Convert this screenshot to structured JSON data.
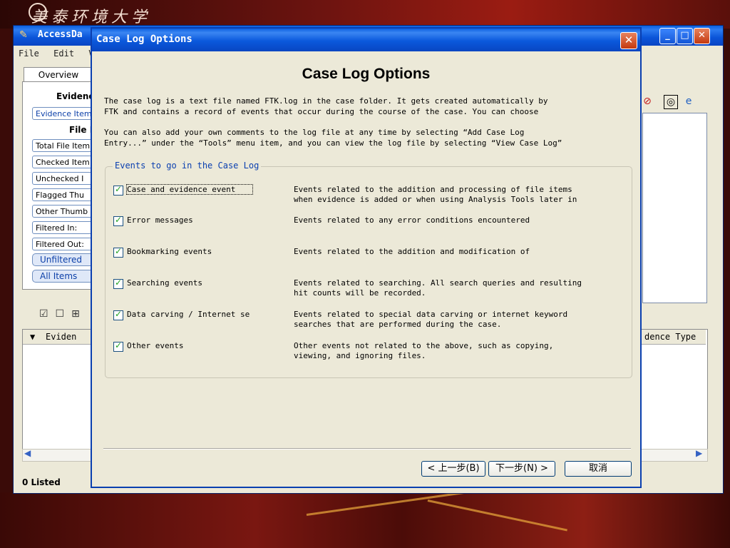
{
  "background": {
    "logo_text": "美泰环境大学",
    "colors": {
      "dark_red": "#3a0b08",
      "accent_gold": "#e3a23a"
    }
  },
  "main_window": {
    "title": "AccessDa",
    "menu": [
      "File",
      "Edit",
      "V"
    ],
    "tab": "Overview",
    "headings": {
      "evidence": "Evidenc",
      "file": "File I"
    },
    "left_buttons": [
      "Evidence Item",
      "Total File Item",
      "Checked Item",
      "Unchecked I",
      "Flagged Thu",
      "Other Thumb",
      "Filtered In:",
      "Filtered Out:"
    ],
    "filter_buttons": [
      "Unfiltered",
      "All Items"
    ],
    "list_columns": {
      "left": "Eviden",
      "right": "dence Type"
    },
    "status": "0 Listed"
  },
  "dialog": {
    "title": "Case Log Options",
    "heading": "Case Log Options",
    "paragraph1": "The case log is a text file named FTK.log in the case folder. It gets created automatically by\nFTK and contains a record of events that occur during the course of the case. You can choose",
    "paragraph2": "You can also add your own comments to the log file at any time by selecting “Add Case Log\nEntry...” under the “Tools” menu item, and you can view the log file by selecting “View Case Log”",
    "group_label": "Events to go in the Case Log",
    "events": [
      {
        "name": "Case and evidence event",
        "checked": true,
        "description": "Events related to the addition and processing of file items when evidence is added or when using Analysis Tools later in the case."
      },
      {
        "name": "Error messages",
        "checked": true,
        "description": "Events related to any error conditions encountered"
      },
      {
        "name": "Bookmarking events",
        "checked": true,
        "description": "Events related to the addition and modification of"
      },
      {
        "name": "Searching events",
        "checked": true,
        "description": "Events related to searching. All search queries and resulting hit counts will be recorded."
      },
      {
        "name": "Data carving / Internet se",
        "checked": true,
        "description": "Events related to special data carving or internet keyword searches that are performed during the case."
      },
      {
        "name": "Other events",
        "checked": true,
        "description": "Other events not related to the above, such as copying, viewing, and ignoring files."
      }
    ],
    "buttons": {
      "back": "< 上一步(B)",
      "next": "下一步(N) >",
      "cancel": "取消"
    }
  }
}
